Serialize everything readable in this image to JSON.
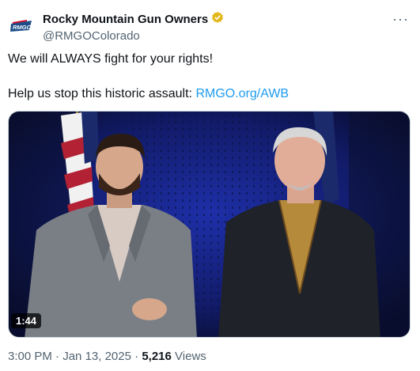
{
  "account": {
    "display_name": "Rocky Mountain Gun Owners",
    "handle": "@RMGOColorado",
    "avatar_text": "RMGO"
  },
  "post": {
    "line1": "We will ALWAYS fight for your rights!",
    "line2_prefix": "Help us stop this historic assault:",
    "link": "RMGO.org/AWB"
  },
  "media": {
    "duration": "1:44"
  },
  "meta": {
    "time": "3:00 PM",
    "sep1": " · ",
    "date": "Jan 13, 2025",
    "sep2": " · ",
    "views_count": "5,216",
    "views_label": "Views"
  },
  "colors": {
    "link": "#1d9bf0",
    "verified_badge": "#e2b719"
  },
  "icons": [
    "verified-badge-icon",
    "more-options-icon"
  ]
}
